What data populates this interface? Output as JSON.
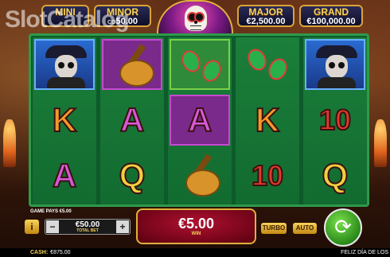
{
  "watermark": "SlotCatalog",
  "jackpots": {
    "mini": {
      "label": "MINI",
      "prefix": "",
      "value": ""
    },
    "minor": {
      "label": "MINOR",
      "prefix": "CO",
      "value": "50.00"
    },
    "major": {
      "label": "MAJOR",
      "prefix": "",
      "value": "€2,500.00"
    },
    "grand": {
      "label": "GRAND",
      "prefix": "",
      "value": "€100,000.00"
    }
  },
  "reels": [
    [
      "skeleton-man",
      "K",
      "A"
    ],
    [
      "guitar",
      "A",
      "Q"
    ],
    [
      "maracas",
      "A",
      "guitar"
    ],
    [
      "maracas",
      "K",
      "10"
    ],
    [
      "skeleton-man",
      "10",
      "Q"
    ]
  ],
  "panel": {
    "game_pays": "GAME PAYS €5.00",
    "info": "i",
    "bet_minus": "−",
    "bet_plus": "+",
    "bet_value": "€50.00",
    "bet_label": "TOTAL BET",
    "win_value": "€5.00",
    "win_label": "WIN",
    "turbo": "TURBO",
    "auto": "AUTO",
    "spin": "⟳"
  },
  "status": {
    "cash_label": "CASH:",
    "cash_value": "€875.00",
    "game_title": "FELIZ DÍA DE LOS"
  },
  "colors": {
    "accent": "#e0b03a",
    "reel_bg": "#1b7f3a",
    "spin": "#2a8a1a"
  }
}
